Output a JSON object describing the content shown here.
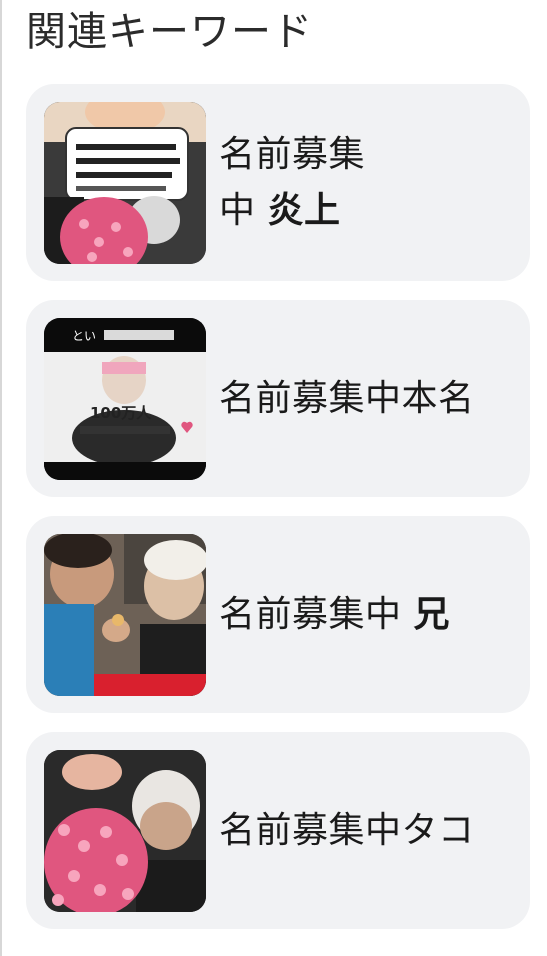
{
  "section": {
    "title": "関連キーワード"
  },
  "keywords": [
    {
      "line1": "名前募集",
      "line2_plain": "中 ",
      "line2_strong": "炎上"
    },
    {
      "plain": "名前募集中本名",
      "strong": ""
    },
    {
      "plain": "名前募集中 ",
      "strong": "兄"
    },
    {
      "plain": "名前募集中タコ",
      "strong": ""
    }
  ],
  "thumbnails": {
    "t2_caption": "とい",
    "t2_count": "100万人"
  },
  "colors": {
    "card_bg": "#f1f2f4",
    "text": "#1a1a1a",
    "accent_pink": "#e0567f"
  }
}
